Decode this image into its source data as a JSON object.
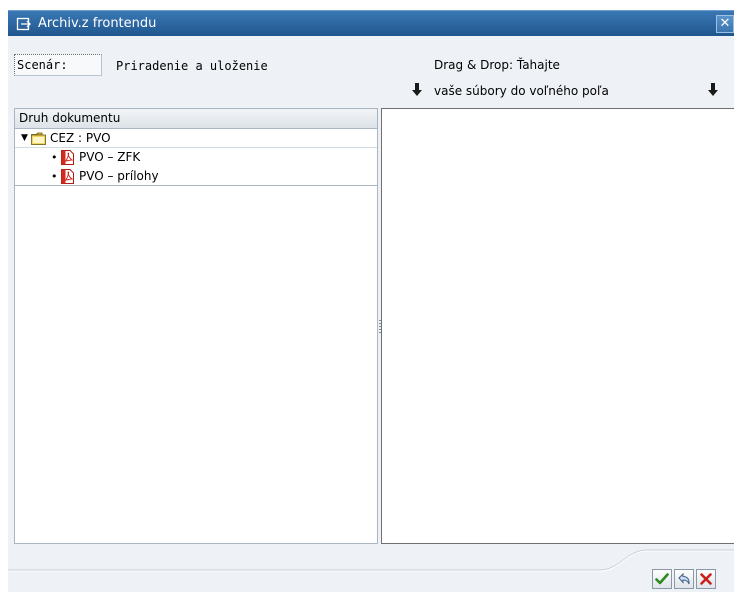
{
  "window": {
    "title": "Archiv.z frontendu",
    "close_glyph": "✕"
  },
  "scenario": {
    "label": "Scenár:",
    "value": "Priradenie a uloženie"
  },
  "drag_drop": {
    "line1": "Drag & Drop: Ťahajte",
    "line2": "vaše súbory do voľného poľa"
  },
  "tree": {
    "header": "Druh dokumentu",
    "root": {
      "label": "CEZ : PVO",
      "icon": "folder-open-icon"
    },
    "children": [
      {
        "label": "PVO – ZFK",
        "icon": "pdf-icon"
      },
      {
        "label": "PVO – prílohy",
        "icon": "pdf-icon"
      }
    ]
  },
  "footer_buttons": [
    {
      "name": "confirm",
      "icon": "checkmark-icon"
    },
    {
      "name": "undo",
      "icon": "undo-icon"
    },
    {
      "name": "cancel",
      "icon": "cancel-icon"
    }
  ],
  "colors": {
    "titlebar": "#2d6aa3",
    "dialog_bg": "#eef2f6",
    "pdf_red": "#d12a1f",
    "folder_yellow": "#f2d660"
  }
}
